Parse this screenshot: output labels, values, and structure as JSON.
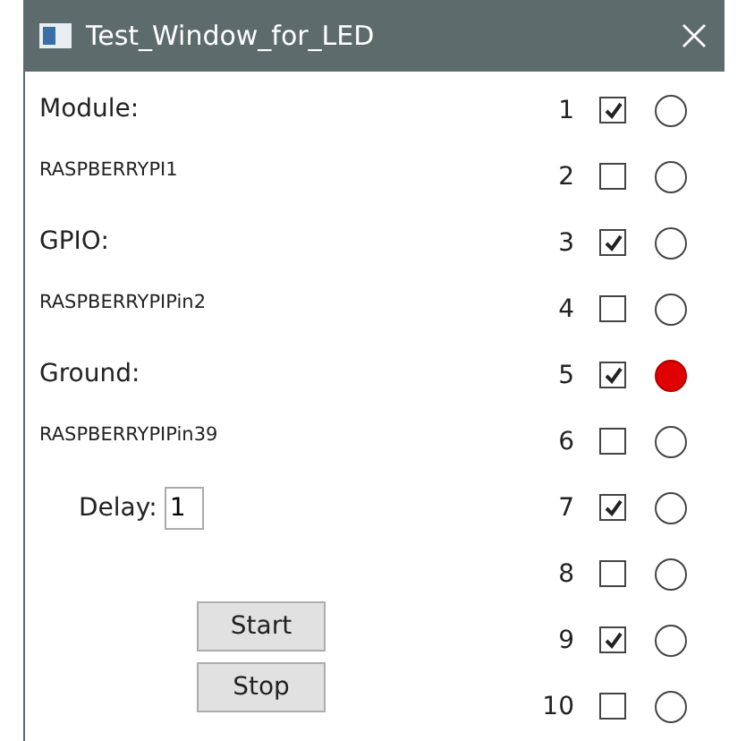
{
  "window": {
    "title": "Test_Window_for_LED"
  },
  "fields": [
    {
      "label": "Module:",
      "value": "RASPBERRYPI1"
    },
    {
      "label": "GPIO:",
      "value": "RASPBERRYPIPin2"
    },
    {
      "label": "Ground:",
      "value": "RASPBERRYPIPin39"
    }
  ],
  "delay": {
    "label": "Delay:",
    "value": "1"
  },
  "buttons": [
    "Start",
    "Stop"
  ],
  "leds": [
    {
      "number": "1",
      "checked": true,
      "on": false
    },
    {
      "number": "2",
      "checked": false,
      "on": false
    },
    {
      "number": "3",
      "checked": true,
      "on": false
    },
    {
      "number": "4",
      "checked": false,
      "on": false
    },
    {
      "number": "5",
      "checked": true,
      "on": true
    },
    {
      "number": "6",
      "checked": false,
      "on": false
    },
    {
      "number": "7",
      "checked": true,
      "on": false
    },
    {
      "number": "8",
      "checked": false,
      "on": false
    },
    {
      "number": "9",
      "checked": true,
      "on": false
    },
    {
      "number": "10",
      "checked": false,
      "on": false
    }
  ]
}
